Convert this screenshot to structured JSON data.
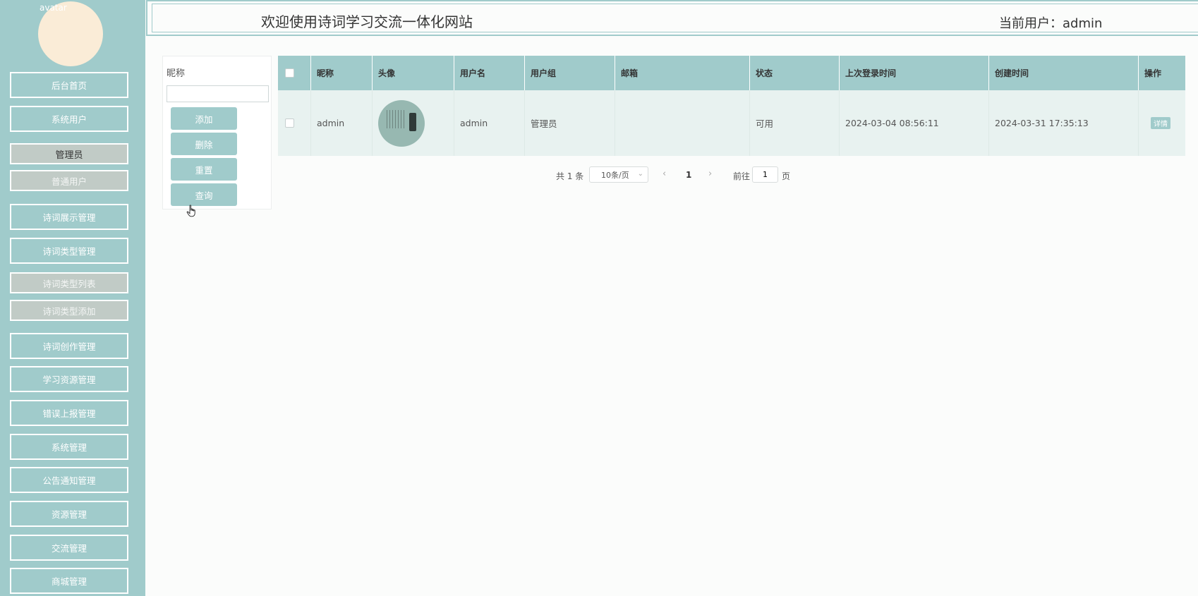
{
  "header": {
    "site_title": "欢迎使用诗词学习交流一体化网站",
    "current_user": "当前用户：admin"
  },
  "sidebar": {
    "avatar_alt": "avatar",
    "items": [
      {
        "label": "后台首页"
      },
      {
        "label": "系统用户"
      },
      {
        "label": "管理员",
        "sub": true,
        "active": true
      },
      {
        "label": "普通用户",
        "sub": true
      },
      {
        "label": "诗词展示管理"
      },
      {
        "label": "诗词类型管理"
      },
      {
        "label": "诗词类型列表",
        "sub": true
      },
      {
        "label": "诗词类型添加",
        "sub": true
      },
      {
        "label": "诗词创作管理"
      },
      {
        "label": "学习资源管理"
      },
      {
        "label": "错误上报管理"
      },
      {
        "label": "系统管理"
      },
      {
        "label": "公告通知管理"
      },
      {
        "label": "资源管理"
      },
      {
        "label": "交流管理"
      },
      {
        "label": "商城管理"
      }
    ]
  },
  "search": {
    "label": "昵称",
    "placeholder": "",
    "buttons": {
      "add": "添加",
      "delete": "删除",
      "reset": "重置",
      "query": "查询"
    }
  },
  "table": {
    "columns": [
      "昵称",
      "头像",
      "用户名",
      "用户组",
      "邮箱",
      "状态",
      "上次登录时间",
      "创建时间",
      "操作"
    ],
    "rows": [
      {
        "nickname": "admin",
        "username": "admin",
        "group": "管理员",
        "email": "",
        "status": "可用",
        "last_login": "2024-03-04 08:56:11",
        "created": "2024-03-31 17:35:13",
        "action": "详情"
      }
    ]
  },
  "pagination": {
    "total": "共 1 条",
    "page_size": "10条/页",
    "current_page": "1",
    "goto_label": "前往",
    "goto_value": "1",
    "goto_unit": "页"
  },
  "colors": {
    "accent": "#a0cbcb",
    "avatar_bg": "#faecd7",
    "submenu_bg": "#c1cbc6"
  }
}
